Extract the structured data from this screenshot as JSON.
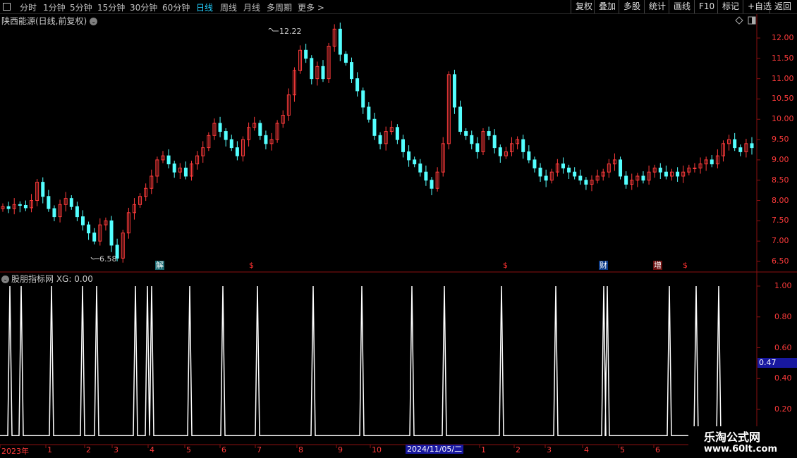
{
  "toolbar": {
    "periods": [
      "分时",
      "1分钟",
      "5分钟",
      "15分钟",
      "30分钟",
      "60分钟",
      "日线",
      "周线",
      "月线",
      "多周期",
      "更多 >"
    ],
    "active_period": "日线",
    "right_buttons": [
      "复权",
      "叠加",
      "多股",
      "统计",
      "画线",
      "F10",
      "标记",
      "+自选",
      "返回"
    ]
  },
  "main_chart": {
    "title": "陕西能源(日线,前复权)",
    "high_marker": "12.22",
    "low_marker": "6.58",
    "y_ticks": [
      "12.00",
      "11.50",
      "11.00",
      "10.50",
      "10.00",
      "9.50",
      "9.00",
      "8.50",
      "8.00",
      "7.50",
      "7.00",
      "6.50"
    ],
    "events": [
      {
        "text": "解",
        "type": "jie"
      },
      {
        "text": "$",
        "type": "s"
      },
      {
        "text": "$",
        "type": "s"
      },
      {
        "text": "财",
        "type": "cai"
      },
      {
        "text": "增",
        "type": "zeng"
      },
      {
        "text": "$",
        "type": "s"
      }
    ]
  },
  "indicator": {
    "title": "股朋指标网 XG: 0.00",
    "y_ticks": [
      "1.00",
      "0.80",
      "0.60",
      "0.40",
      "0.20"
    ],
    "cursor_value": "0.47"
  },
  "date_axis": {
    "labels": [
      "2023年",
      "1",
      "2",
      "3",
      "4",
      "5",
      "6",
      "7",
      "8",
      "9",
      "10",
      "2024/11/05/二",
      "1",
      "2",
      "3",
      "4",
      "5",
      "6"
    ],
    "highlight": "2024/11/05/二"
  },
  "watermark": {
    "title": "乐淘公式网",
    "url": "www.60lt.com"
  },
  "colors": {
    "up": "#ff3b3b",
    "down": "#54ffff",
    "axis": "#ff3b3b",
    "active": "#23d0ff",
    "highlight": "#1818a0"
  },
  "chart_data": {
    "type": "candlestick",
    "title": "陕西能源(日线,前复权)",
    "ylim": [
      6.3,
      12.3
    ],
    "close_series": [
      7.85,
      7.8,
      7.9,
      7.88,
      7.82,
      8.0,
      8.45,
      8.1,
      7.8,
      7.6,
      7.9,
      8.05,
      7.85,
      7.6,
      7.4,
      7.2,
      7.0,
      7.4,
      7.5,
      6.9,
      6.58,
      7.2,
      7.7,
      7.9,
      8.1,
      8.3,
      8.6,
      9.0,
      9.1,
      8.9,
      8.7,
      8.8,
      8.6,
      8.9,
      9.1,
      9.3,
      9.6,
      9.9,
      9.7,
      9.5,
      9.3,
      9.1,
      9.5,
      9.8,
      9.9,
      9.6,
      9.4,
      9.5,
      9.9,
      10.1,
      10.6,
      11.2,
      11.7,
      11.5,
      11.0,
      11.3,
      11.0,
      11.8,
      12.22,
      11.6,
      11.4,
      11.0,
      10.7,
      10.3,
      10.0,
      9.6,
      9.4,
      9.7,
      9.8,
      9.5,
      9.2,
      9.0,
      8.9,
      8.7,
      8.5,
      8.3,
      8.7,
      9.4,
      11.1,
      10.3,
      9.7,
      9.6,
      9.4,
      9.2,
      9.7,
      9.6,
      9.3,
      9.1,
      9.2,
      9.4,
      9.5,
      9.2,
      9.0,
      8.8,
      8.6,
      8.5,
      8.7,
      8.9,
      8.8,
      8.7,
      8.6,
      8.5,
      8.4,
      8.5,
      8.6,
      8.7,
      8.9,
      9.0,
      8.6,
      8.4,
      8.5,
      8.6,
      8.5,
      8.7,
      8.8,
      8.7,
      8.6,
      8.7,
      8.6,
      8.7,
      8.8,
      8.8,
      8.9,
      9.0,
      8.9,
      9.1,
      9.4,
      9.5,
      9.3,
      9.2,
      9.4,
      9.3
    ],
    "x_labels": [
      "2023年",
      "1",
      "2",
      "3",
      "4",
      "5",
      "6",
      "7",
      "8",
      "9",
      "10",
      "2024/11/05/二",
      "1",
      "2",
      "3",
      "4",
      "5",
      "6"
    ]
  }
}
